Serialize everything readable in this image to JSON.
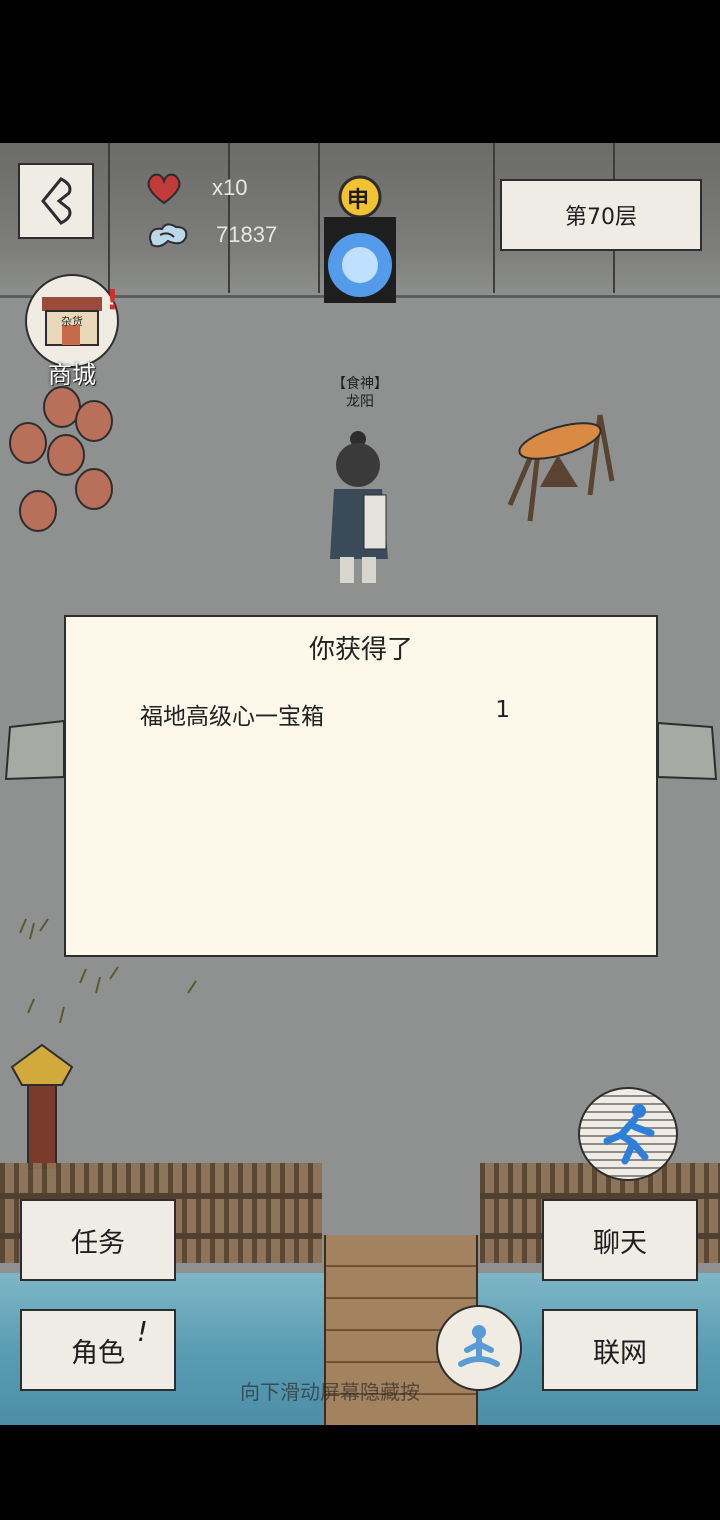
{
  "hud": {
    "lives": "x10",
    "currency": "71837",
    "floor": "第70层"
  },
  "portal": {
    "glyph": "申"
  },
  "shop": {
    "sign": "杂货",
    "label": "商城"
  },
  "npc": {
    "title": "【食神】",
    "name": "龙阳"
  },
  "dialog": {
    "title": "你获得了",
    "items": [
      {
        "name": "福地高级心一宝箱",
        "qty": "1"
      }
    ]
  },
  "menu": {
    "tasks": "任务",
    "chat": "聊天",
    "role": "角色",
    "role_badge": "!",
    "network": "联网"
  },
  "hint": "向下滑动屏幕隐藏按",
  "colors": {
    "panel": "#fdf8e9",
    "button": "#efece6",
    "border": "#2d2d2d",
    "heart": "#c23a3a",
    "portal": "#5aa8ff"
  }
}
